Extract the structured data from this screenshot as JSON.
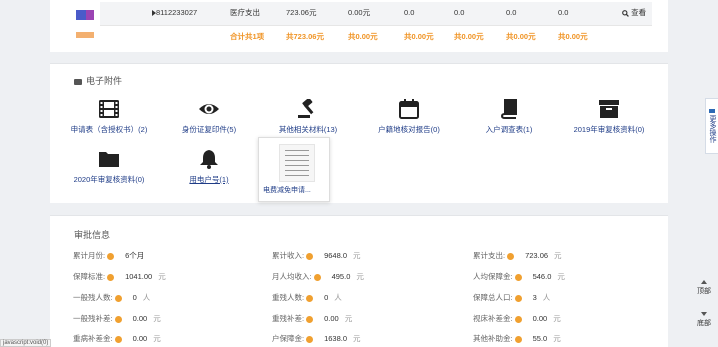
{
  "table": {
    "row": {
      "id": "8112233027",
      "type": "医疗支出",
      "amount1": "723.06元",
      "amount2": "0.00元",
      "v1": "0.0",
      "v2": "0.0",
      "v3": "0.0",
      "v4": "0.0",
      "view_label": "查看"
    },
    "total": {
      "count": "合计共1项",
      "sum1": "共723.06元",
      "sum2": "共0.00元",
      "sum3": "共0.00元",
      "sum4": "共0.00元",
      "sum5": "共0.00元",
      "sum6": "共0.00元"
    }
  },
  "attachments": {
    "title": "电子附件",
    "items": [
      {
        "label": "申请表（含授权书）(2)",
        "icon": "film-icon"
      },
      {
        "label": "身份证复印件(5)",
        "icon": "eye-icon"
      },
      {
        "label": "其他相关材料(13)",
        "icon": "gavel-icon"
      },
      {
        "label": "户籍地核对报告(0)",
        "icon": "calendar-icon"
      },
      {
        "label": "入户调查表(1)",
        "icon": "book-icon"
      },
      {
        "label": "2019年审复核资料(0)",
        "icon": "archive-icon"
      },
      {
        "label": "2020年审复核资料(0)",
        "icon": "folder-icon"
      },
      {
        "label": "用电户号(1)",
        "icon": "bell-icon"
      }
    ],
    "popup_caption": "电费减免申请..."
  },
  "approval": {
    "title": "审批信息",
    "fields": [
      {
        "k": "累计月份:",
        "v": "6个月",
        "u": ""
      },
      {
        "k": "累计收入:",
        "v": "9648.0",
        "u": "元"
      },
      {
        "k": "累计支出:",
        "v": "723.06",
        "u": "元"
      },
      {
        "k": "保障标准:",
        "v": "1041.00",
        "u": "元"
      },
      {
        "k": "月人均收入:",
        "v": "495.0",
        "u": "元"
      },
      {
        "k": "人均保障金:",
        "v": "546.0",
        "u": "元"
      },
      {
        "k": "一般残人数:",
        "v": "0",
        "u": "人"
      },
      {
        "k": "重残人数:",
        "v": "0",
        "u": "人"
      },
      {
        "k": "保障总人口:",
        "v": "3",
        "u": "人"
      },
      {
        "k": "一般残补差:",
        "v": "0.00",
        "u": "元"
      },
      {
        "k": "重残补差:",
        "v": "0.00",
        "u": "元"
      },
      {
        "k": "视床补差金:",
        "v": "0.00",
        "u": "元"
      },
      {
        "k": "重病补差金:",
        "v": "0.00",
        "u": "元"
      },
      {
        "k": "户保障金:",
        "v": "1638.0",
        "u": "元"
      },
      {
        "k": "其他补助金:",
        "v": "55.0",
        "u": "元"
      }
    ]
  },
  "side": {
    "tab_label": "更多操作",
    "top_label": "顶部",
    "bottom_label": "底部"
  },
  "status_text": "javascript:void(0)"
}
